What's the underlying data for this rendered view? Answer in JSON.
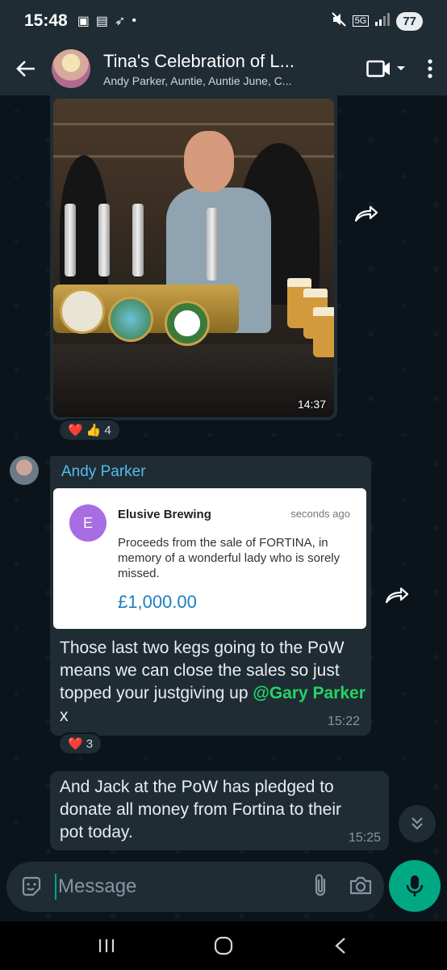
{
  "status_bar": {
    "time": "15:48",
    "battery": "77",
    "network": "5G"
  },
  "header": {
    "title": "Tina's Celebration of L...",
    "subtitle": "Andy Parker, Auntie, Auntie June, C..."
  },
  "messages": {
    "image_message": {
      "time": "14:37",
      "reactions": [
        "❤️",
        "👍"
      ],
      "reaction_count": "4"
    },
    "andy_message": {
      "sender": "Andy Parker",
      "card": {
        "avatar_letter": "E",
        "name": "Elusive Brewing",
        "time": "seconds ago",
        "body": "Proceeds from the sale of FORTINA, in memory of a wonderful lady who is sorely missed.",
        "amount": "£1,000.00"
      },
      "text": "Those last two kegs going to the PoW means we can close the sales so just topped your justgiving up",
      "mention": "@Gary Parker",
      "suffix": " x",
      "time": "15:22",
      "reactions": [
        "❤️"
      ],
      "reaction_count": "3"
    },
    "second_message": {
      "text": "And Jack at the PoW has pledged to donate all money from Fortina to their pot today.",
      "time": "15:25"
    }
  },
  "composer": {
    "placeholder": "Message"
  },
  "colors": {
    "accent": "#00a884",
    "sender_name": "#53bdeb",
    "mention": "#25d366"
  }
}
